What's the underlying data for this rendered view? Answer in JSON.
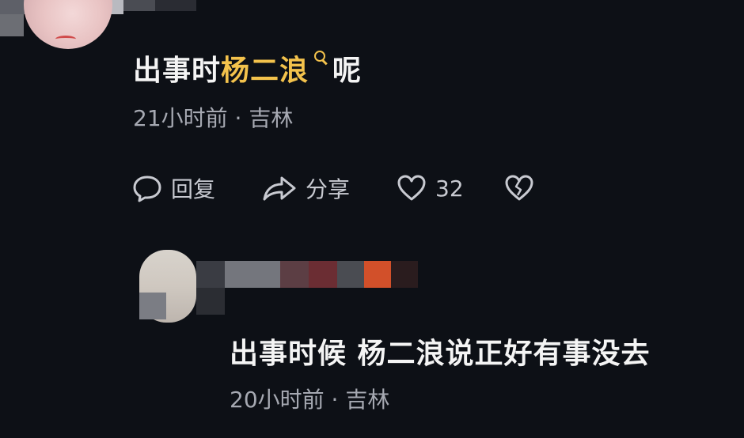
{
  "comment": {
    "text_before": "出事时",
    "highlight": "杨二浪",
    "text_after": "呢",
    "time": "21小时前 · 吉林",
    "actions": {
      "reply_label": "回复",
      "share_label": "分享",
      "like_count": "32"
    },
    "icons": [
      "search-icon",
      "comment-bubble-icon",
      "share-arrow-icon",
      "heart-icon",
      "broken-heart-icon"
    ]
  },
  "reply": {
    "text": "出事时候 杨二浪说正好有事没去",
    "time": "20小时前 · 吉林"
  },
  "colors": {
    "background": "#0d1016",
    "highlight": "#f3c24c",
    "meta": "#a6a9b2"
  }
}
